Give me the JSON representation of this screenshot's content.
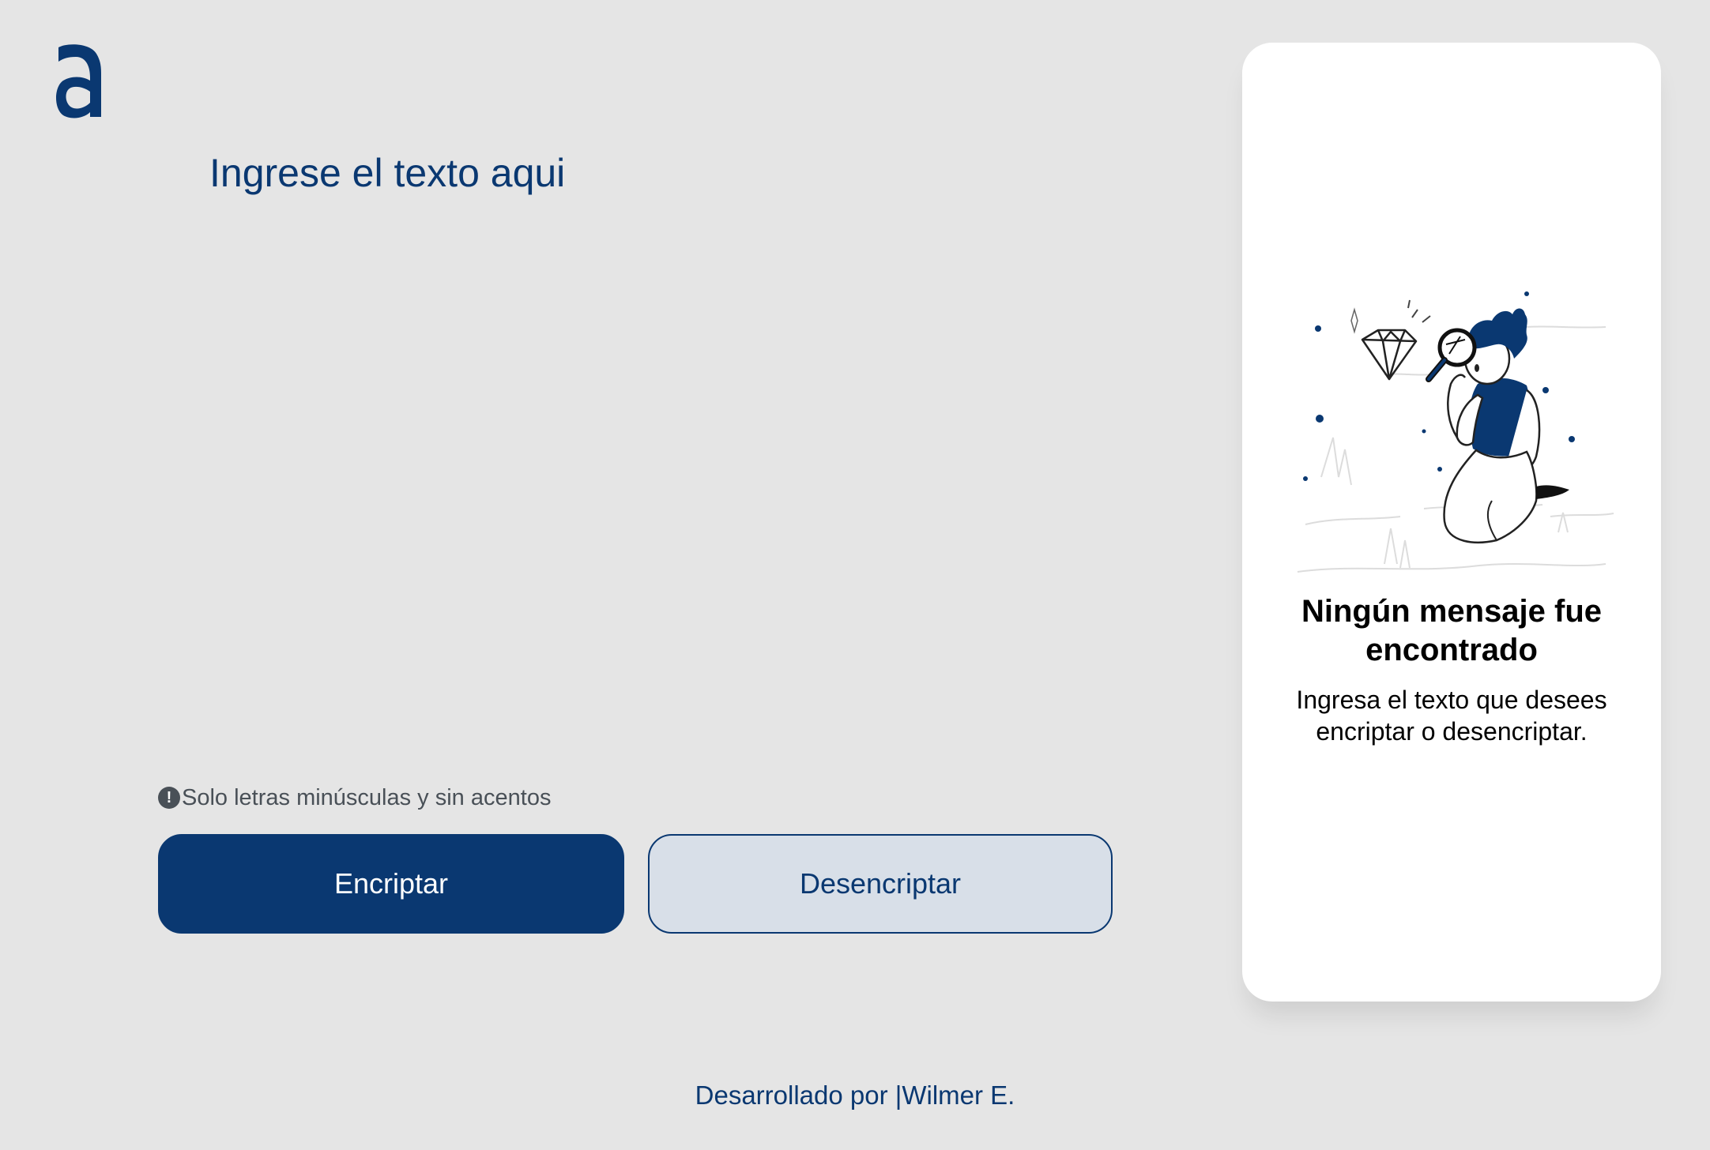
{
  "input": {
    "placeholder": "Ingrese el texto aqui"
  },
  "hint": {
    "icon": "exclamation-circle-icon",
    "text": "Solo letras minúsculas y sin acentos"
  },
  "buttons": {
    "encrypt_label": "Encriptar",
    "decrypt_label": "Desencriptar"
  },
  "result": {
    "title": "Ningún mensaje fue encontrado",
    "text": "Ingresa el texto que desees encriptar o desencriptar."
  },
  "footer": {
    "prefix": "Desarrollado por ",
    "separator": "|",
    "author": "Wilmer E."
  },
  "colors": {
    "primary": "#0a3871",
    "background": "#e5e5e5",
    "secondary_button_bg": "#d8dfe8",
    "hint_text": "#495057",
    "card_bg": "#ffffff"
  }
}
